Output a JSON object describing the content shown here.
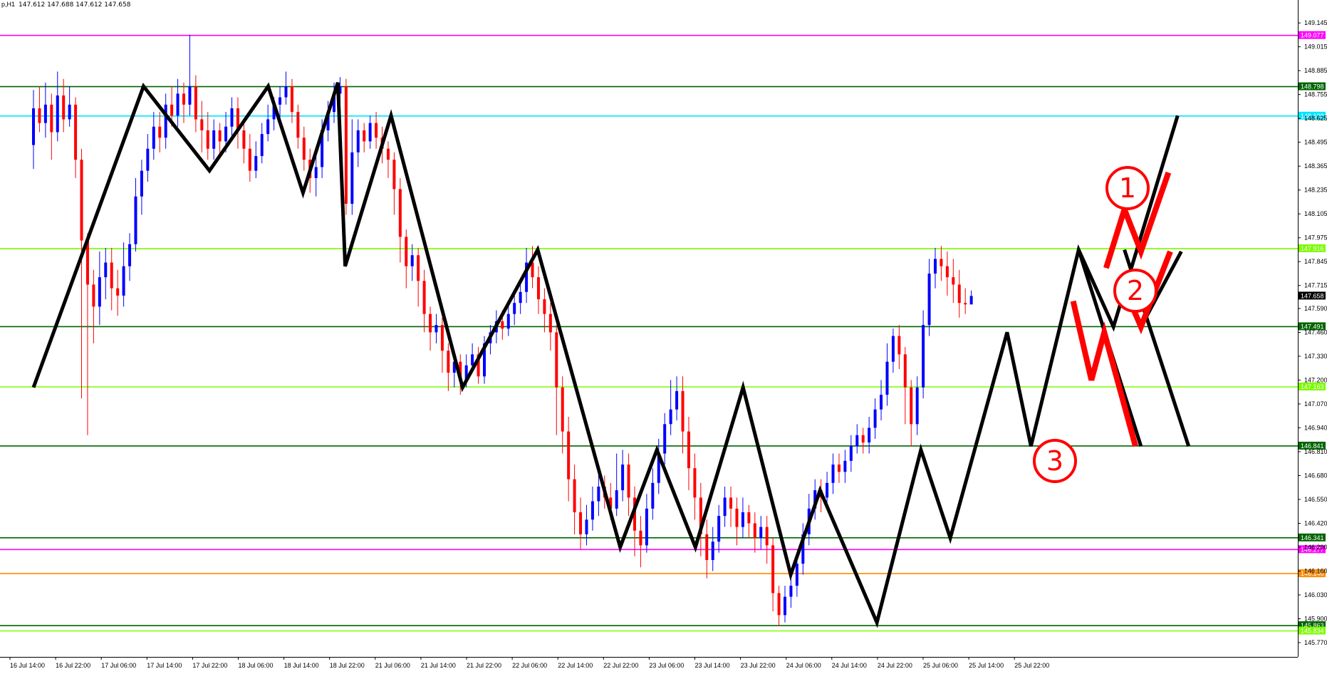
{
  "header": {
    "symbol": "p,H1",
    "ohlc": "147.612 147.688 147.612 147.658"
  },
  "chart_data": {
    "type": "candlestick",
    "timeframe": "H1",
    "ylim": [
      145.77,
      149.2
    ],
    "y_ticks": [
      145.77,
      145.9,
      146.03,
      146.16,
      146.29,
      146.42,
      146.55,
      146.68,
      146.81,
      146.94,
      147.07,
      147.2,
      147.33,
      147.46,
      147.59,
      147.715,
      147.845,
      147.975,
      148.105,
      148.235,
      148.365,
      148.495,
      148.625,
      148.755,
      148.885,
      149.015,
      149.145
    ],
    "y_tick_labels": [
      "145.770",
      "145.900",
      "146.030",
      "146.160",
      "146.290",
      "146.420",
      "146.550",
      "146.680",
      "146.810",
      "146.940",
      "147.070",
      "147.200",
      "147.330",
      "147.460",
      "147.590",
      "147.715",
      "147.845",
      "147.975",
      "148.105",
      "148.235",
      "148.365",
      "148.495",
      "148.625",
      "148.755",
      "148.885",
      "149.015",
      "149.145"
    ],
    "x_labels": [
      "16 Jul 14:00",
      "16 Jul 22:00",
      "17 Jul 06:00",
      "17 Jul 14:00",
      "17 Jul 22:00",
      "18 Jul 06:00",
      "18 Jul 14:00",
      "18 Jul 22:00",
      "21 Jul 06:00",
      "21 Jul 14:00",
      "21 Jul 22:00",
      "22 Jul 06:00",
      "22 Jul 14:00",
      "22 Jul 22:00",
      "23 Jul 06:00",
      "23 Jul 14:00",
      "23 Jul 22:00",
      "24 Jul 06:00",
      "24 Jul 14:00",
      "24 Jul 22:00",
      "25 Jul 06:00",
      "25 Jul 14:00",
      "25 Jul 22:00"
    ],
    "current_price": {
      "value": 147.658,
      "label": "147.658",
      "color": "#000000"
    },
    "horizontal_levels": [
      {
        "value": 149.077,
        "label": "149.077",
        "color": "#ff00ff"
      },
      {
        "value": 148.798,
        "label": "148.798",
        "color": "#006400"
      },
      {
        "value": 148.638,
        "label": "148.638",
        "color": "#00e5ff"
      },
      {
        "value": 147.916,
        "label": "147.916",
        "color": "#7cfc00"
      },
      {
        "value": 147.491,
        "label": "147.491",
        "color": "#006400"
      },
      {
        "value": 147.163,
        "label": "147.163",
        "color": "#7cfc00"
      },
      {
        "value": 146.841,
        "label": "146.841",
        "color": "#006400"
      },
      {
        "value": 146.341,
        "label": "146.341",
        "color": "#006400"
      },
      {
        "value": 146.277,
        "label": "146.277",
        "color": "#ff00ff"
      },
      {
        "value": 146.146,
        "label": "146.146",
        "color": "#ff8c00"
      },
      {
        "value": 145.863,
        "label": "145.863",
        "color": "#006400"
      },
      {
        "value": 145.834,
        "label": "145.834",
        "color": "#7cfc00"
      }
    ],
    "zigzag": [
      {
        "x": 0.0,
        "y": 147.16
      },
      {
        "x": 6.0,
        "y": 148.8
      },
      {
        "x": 9.6,
        "y": 148.34
      },
      {
        "x": 12.8,
        "y": 148.8
      },
      {
        "x": 14.7,
        "y": 148.22
      },
      {
        "x": 16.6,
        "y": 148.82
      },
      {
        "x": 17.0,
        "y": 147.82
      },
      {
        "x": 19.5,
        "y": 148.64
      },
      {
        "x": 23.4,
        "y": 147.16
      },
      {
        "x": 27.5,
        "y": 147.91
      },
      {
        "x": 32.0,
        "y": 146.29
      },
      {
        "x": 34.0,
        "y": 146.82
      },
      {
        "x": 36.1,
        "y": 146.29
      },
      {
        "x": 38.7,
        "y": 147.16
      },
      {
        "x": 41.3,
        "y": 146.14
      },
      {
        "x": 42.9,
        "y": 146.6
      },
      {
        "x": 46.0,
        "y": 145.88
      },
      {
        "x": 48.4,
        "y": 146.82
      },
      {
        "x": 50.0,
        "y": 146.34
      },
      {
        "x": 53.1,
        "y": 147.46
      },
      {
        "x": 54.4,
        "y": 146.84
      },
      {
        "x": 57.0,
        "y": 147.91
      },
      {
        "x": 58.9,
        "y": 147.49
      },
      {
        "x": 62.4,
        "y": 148.64
      }
    ],
    "projection_lines": [
      [
        {
          "x": 57.0,
          "y": 147.91
        },
        {
          "x": 60.4,
          "y": 146.84
        }
      ],
      [
        {
          "x": 59.5,
          "y": 147.91
        },
        {
          "x": 63.0,
          "y": 146.84
        }
      ],
      [
        {
          "x": 60.4,
          "y": 147.49
        },
        {
          "x": 62.6,
          "y": 147.9
        }
      ]
    ],
    "scenarios": [
      {
        "label": "①",
        "path": [
          {
            "x": 58.5,
            "y": 147.81
          },
          {
            "x": 59.5,
            "y": 148.13
          },
          {
            "x": 60.4,
            "y": 147.9
          },
          {
            "x": 61.9,
            "y": 148.33
          }
        ]
      },
      {
        "label": "②",
        "path": [
          {
            "x": 59.8,
            "y": 147.63
          },
          {
            "x": 60.4,
            "y": 147.49
          },
          {
            "x": 62.0,
            "y": 147.9
          }
        ]
      },
      {
        "label": "③",
        "path": [
          {
            "x": 56.7,
            "y": 147.63
          },
          {
            "x": 57.7,
            "y": 147.2
          },
          {
            "x": 58.4,
            "y": 147.46
          },
          {
            "x": 60.1,
            "y": 146.84
          }
        ]
      }
    ],
    "scenario_color": "#ff0000",
    "bull_color": "#0000ff",
    "bear_color": "#ff0000",
    "candles": [
      [
        148.48,
        148.68,
        148.35,
        148.78
      ],
      [
        148.68,
        148.6,
        148.55,
        148.8
      ],
      [
        148.6,
        148.7,
        148.52,
        148.82
      ],
      [
        148.7,
        148.55,
        148.4,
        148.76
      ],
      [
        148.55,
        148.75,
        148.5,
        148.88
      ],
      [
        148.75,
        148.62,
        148.55,
        148.84
      ],
      [
        148.62,
        148.7,
        148.58,
        148.8
      ],
      [
        148.7,
        148.4,
        148.3,
        148.74
      ],
      [
        148.4,
        147.96,
        147.1,
        148.46
      ],
      [
        147.96,
        147.72,
        146.9,
        148.0
      ],
      [
        147.72,
        147.6,
        147.4,
        147.8
      ],
      [
        147.6,
        147.76,
        147.5,
        147.9
      ],
      [
        147.76,
        147.84,
        147.64,
        147.92
      ],
      [
        147.84,
        147.7,
        147.58,
        147.92
      ],
      [
        147.7,
        147.66,
        147.55,
        147.8
      ],
      [
        147.66,
        147.82,
        147.6,
        147.95
      ],
      [
        147.82,
        147.94,
        147.74,
        148.0
      ],
      [
        147.94,
        148.2,
        147.9,
        148.3
      ],
      [
        148.2,
        148.34,
        148.1,
        148.4
      ],
      [
        148.34,
        148.46,
        148.28,
        148.54
      ],
      [
        148.46,
        148.58,
        148.4,
        148.66
      ],
      [
        148.58,
        148.52,
        148.44,
        148.66
      ],
      [
        148.52,
        148.7,
        148.46,
        148.76
      ],
      [
        148.7,
        148.64,
        148.58,
        148.8
      ],
      [
        148.64,
        148.76,
        148.58,
        148.84
      ],
      [
        148.76,
        148.7,
        148.6,
        148.82
      ],
      [
        148.7,
        148.8,
        148.64,
        149.08
      ],
      [
        148.8,
        148.62,
        148.55,
        148.86
      ],
      [
        148.62,
        148.56,
        148.44,
        148.72
      ],
      [
        148.56,
        148.46,
        148.4,
        148.66
      ],
      [
        148.46,
        148.56,
        148.4,
        148.62
      ],
      [
        148.56,
        148.5,
        148.42,
        148.6
      ],
      [
        148.5,
        148.58,
        148.44,
        148.66
      ],
      [
        148.58,
        148.68,
        148.52,
        148.74
      ],
      [
        148.68,
        148.56,
        148.46,
        148.74
      ],
      [
        148.56,
        148.46,
        148.38,
        148.62
      ],
      [
        148.46,
        148.34,
        148.28,
        148.54
      ],
      [
        148.34,
        148.42,
        148.3,
        148.5
      ],
      [
        148.42,
        148.54,
        148.38,
        148.6
      ],
      [
        148.54,
        148.62,
        148.5,
        148.7
      ],
      [
        148.62,
        148.7,
        148.56,
        148.74
      ],
      [
        148.7,
        148.74,
        148.62,
        148.8
      ],
      [
        148.74,
        148.8,
        148.7,
        148.88
      ],
      [
        148.8,
        148.66,
        148.6,
        148.84
      ],
      [
        148.66,
        148.52,
        148.46,
        148.7
      ],
      [
        148.52,
        148.4,
        148.34,
        148.58
      ],
      [
        148.4,
        148.3,
        148.22,
        148.46
      ],
      [
        148.3,
        148.36,
        148.2,
        148.42
      ],
      [
        148.36,
        148.56,
        148.3,
        148.62
      ],
      [
        148.56,
        148.66,
        148.5,
        148.72
      ],
      [
        148.66,
        148.76,
        148.6,
        148.82
      ],
      [
        148.76,
        148.8,
        148.7,
        148.85
      ],
      [
        148.8,
        148.16,
        148.1,
        148.84
      ],
      [
        148.16,
        148.44,
        148.1,
        148.62
      ],
      [
        148.44,
        148.56,
        148.36,
        148.62
      ],
      [
        148.56,
        148.5,
        148.44,
        148.6
      ],
      [
        148.5,
        148.6,
        148.46,
        148.64
      ],
      [
        148.6,
        148.52,
        148.46,
        148.66
      ],
      [
        148.52,
        148.46,
        148.38,
        148.58
      ],
      [
        148.46,
        148.4,
        148.3,
        148.5
      ],
      [
        148.4,
        148.24,
        148.1,
        148.44
      ],
      [
        148.24,
        147.98,
        147.84,
        148.3
      ],
      [
        147.98,
        147.82,
        147.7,
        148.02
      ],
      [
        147.82,
        147.88,
        147.74,
        147.94
      ],
      [
        147.88,
        147.74,
        147.6,
        147.92
      ],
      [
        147.74,
        147.56,
        147.46,
        147.8
      ],
      [
        147.56,
        147.46,
        147.36,
        147.6
      ],
      [
        147.46,
        147.5,
        147.4,
        147.56
      ],
      [
        147.5,
        147.36,
        147.24,
        147.54
      ],
      [
        147.36,
        147.24,
        147.14,
        147.4
      ],
      [
        147.24,
        147.3,
        147.16,
        147.36
      ],
      [
        147.3,
        147.2,
        147.12,
        147.34
      ],
      [
        147.2,
        147.28,
        147.16,
        147.34
      ],
      [
        147.28,
        147.34,
        147.24,
        147.4
      ],
      [
        147.34,
        147.22,
        147.18,
        147.38
      ],
      [
        147.22,
        147.4,
        147.18,
        147.44
      ],
      [
        147.4,
        147.46,
        147.34,
        147.5
      ],
      [
        147.46,
        147.52,
        147.4,
        147.58
      ],
      [
        147.52,
        147.48,
        147.42,
        147.58
      ],
      [
        147.48,
        147.56,
        147.44,
        147.62
      ],
      [
        147.56,
        147.62,
        147.5,
        147.68
      ],
      [
        147.62,
        147.68,
        147.56,
        147.74
      ],
      [
        147.68,
        147.84,
        147.62,
        147.92
      ],
      [
        147.84,
        147.76,
        147.7,
        147.93
      ],
      [
        147.76,
        147.64,
        147.56,
        147.82
      ],
      [
        147.64,
        147.56,
        147.46,
        147.7
      ],
      [
        147.56,
        147.46,
        147.36,
        147.62
      ],
      [
        147.46,
        147.16,
        146.9,
        147.5
      ],
      [
        147.16,
        146.92,
        146.8,
        147.22
      ],
      [
        146.92,
        146.66,
        146.54,
        147.0
      ],
      [
        146.66,
        146.48,
        146.36,
        146.74
      ],
      [
        146.48,
        146.36,
        146.28,
        146.56
      ],
      [
        146.36,
        146.44,
        146.3,
        146.52
      ],
      [
        146.44,
        146.54,
        146.38,
        146.62
      ],
      [
        146.54,
        146.62,
        146.46,
        146.72
      ],
      [
        146.62,
        146.56,
        146.5,
        146.68
      ],
      [
        146.56,
        146.5,
        146.44,
        146.64
      ],
      [
        146.5,
        146.6,
        146.46,
        146.8
      ],
      [
        146.6,
        146.74,
        146.54,
        146.82
      ],
      [
        146.74,
        146.56,
        146.46,
        146.8
      ],
      [
        146.56,
        146.38,
        146.24,
        146.62
      ],
      [
        146.38,
        146.3,
        146.18,
        146.46
      ],
      [
        146.3,
        146.5,
        146.26,
        146.58
      ],
      [
        146.5,
        146.64,
        146.44,
        146.72
      ],
      [
        146.64,
        146.8,
        146.58,
        146.88
      ],
      [
        146.8,
        146.96,
        146.74,
        147.02
      ],
      [
        146.96,
        147.04,
        146.9,
        147.2
      ],
      [
        147.04,
        147.14,
        146.98,
        147.22
      ],
      [
        147.14,
        146.92,
        146.8,
        147.22
      ],
      [
        146.92,
        146.72,
        146.6,
        147.0
      ],
      [
        146.72,
        146.56,
        146.44,
        146.8
      ],
      [
        146.56,
        146.36,
        146.24,
        146.64
      ],
      [
        146.36,
        146.22,
        146.12,
        146.44
      ],
      [
        146.22,
        146.32,
        146.16,
        146.4
      ],
      [
        146.32,
        146.46,
        146.26,
        146.52
      ],
      [
        146.46,
        146.56,
        146.4,
        146.62
      ],
      [
        146.56,
        146.5,
        146.4,
        146.62
      ],
      [
        146.5,
        146.4,
        146.3,
        146.56
      ],
      [
        146.4,
        146.48,
        146.34,
        146.56
      ],
      [
        146.48,
        146.42,
        146.34,
        146.52
      ],
      [
        146.42,
        146.34,
        146.26,
        146.48
      ],
      [
        146.34,
        146.4,
        146.28,
        146.46
      ],
      [
        146.4,
        146.3,
        146.2,
        146.46
      ],
      [
        146.3,
        146.04,
        145.94,
        146.34
      ],
      [
        146.04,
        145.92,
        145.86,
        146.08
      ],
      [
        145.92,
        146.02,
        145.88,
        146.08
      ],
      [
        146.02,
        146.08,
        145.96,
        146.14
      ],
      [
        146.08,
        146.2,
        146.02,
        146.26
      ],
      [
        146.2,
        146.36,
        146.14,
        146.42
      ],
      [
        146.36,
        146.5,
        146.3,
        146.58
      ],
      [
        146.5,
        146.6,
        146.44,
        146.66
      ],
      [
        146.6,
        146.56,
        146.48,
        146.66
      ],
      [
        146.56,
        146.64,
        146.5,
        146.7
      ],
      [
        146.64,
        146.74,
        146.58,
        146.8
      ],
      [
        146.74,
        146.7,
        146.64,
        146.8
      ],
      [
        146.7,
        146.76,
        146.64,
        146.82
      ],
      [
        146.76,
        146.84,
        146.7,
        146.9
      ],
      [
        146.84,
        146.9,
        146.8,
        146.96
      ],
      [
        146.9,
        146.86,
        146.8,
        146.94
      ],
      [
        146.86,
        146.94,
        146.8,
        147.0
      ],
      [
        146.94,
        147.04,
        146.88,
        147.1
      ],
      [
        147.04,
        147.12,
        146.98,
        147.2
      ],
      [
        147.12,
        147.3,
        147.06,
        147.4
      ],
      [
        147.3,
        147.44,
        147.24,
        147.48
      ],
      [
        147.44,
        147.34,
        147.26,
        147.5
      ],
      [
        147.34,
        147.16,
        146.96,
        147.38
      ],
      [
        147.16,
        146.96,
        146.84,
        147.2
      ],
      [
        146.96,
        147.16,
        146.9,
        147.22
      ],
      [
        147.16,
        147.5,
        147.1,
        147.58
      ],
      [
        147.5,
        147.78,
        147.44,
        147.86
      ],
      [
        147.78,
        147.86,
        147.7,
        147.92
      ],
      [
        147.86,
        147.82,
        147.74,
        147.93
      ],
      [
        147.82,
        147.76,
        147.66,
        147.9
      ],
      [
        147.76,
        147.72,
        147.62,
        147.86
      ],
      [
        147.72,
        147.62,
        147.54,
        147.8
      ],
      [
        147.62,
        147.612,
        147.56,
        147.7
      ],
      [
        147.612,
        147.658,
        147.612,
        147.688
      ]
    ]
  }
}
